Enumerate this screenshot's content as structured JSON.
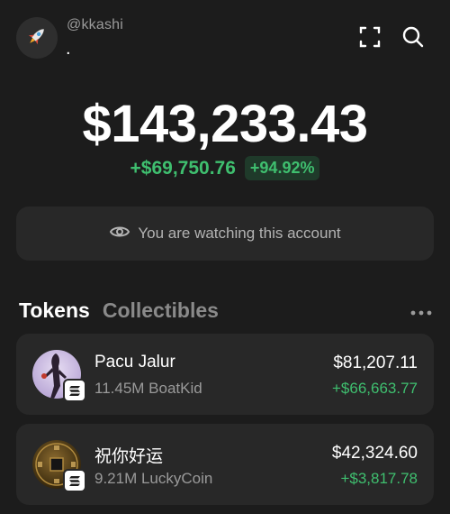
{
  "header": {
    "handle": "@kkashi",
    "subtitle": ".",
    "avatar_icon": "rocket-icon",
    "scan_icon": "scan-icon",
    "search_icon": "search-icon"
  },
  "portfolio": {
    "balance": "$143,233.43",
    "change_amount": "+$69,750.76",
    "change_percent": "+94.92%"
  },
  "watch_banner": {
    "icon": "eye-icon",
    "text": "You are watching this account"
  },
  "tabs": [
    {
      "label": "Tokens",
      "active": true
    },
    {
      "label": "Collectibles",
      "active": false
    }
  ],
  "tokens": [
    {
      "name": "Pacu Jalur",
      "amount": "11.45M BoatKid",
      "value": "$81,207.11",
      "change": "+$66,663.77",
      "icon": "pacu-jalur-token-icon"
    },
    {
      "name": "祝你好运",
      "amount": "9.21M LuckyCoin",
      "value": "$42,324.60",
      "change": "+$3,817.78",
      "icon": "luckycoin-token-icon"
    }
  ],
  "colors": {
    "background": "#1c1c1c",
    "card": "#282828",
    "positive": "#3fbf6f",
    "muted": "#9a9a9a"
  }
}
